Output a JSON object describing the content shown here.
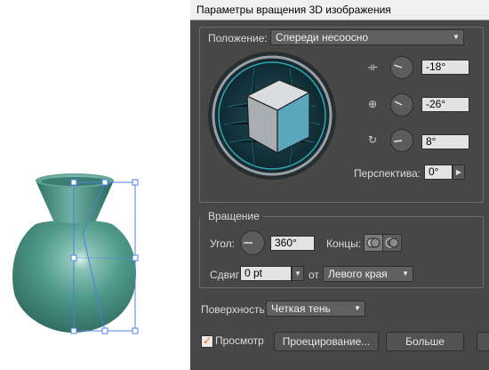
{
  "dialog": {
    "title": "Параметры вращения 3D изображения",
    "position": {
      "label": "Положение:",
      "preset_value": "Спереди несоосно",
      "x_rotation": "-18°",
      "y_rotation": "-26°",
      "z_rotation": "8°",
      "x_dial_angle": -18,
      "y_dial_angle": -26,
      "z_dial_angle": 8,
      "perspective_label": "Перспектива:",
      "perspective_value": "0°"
    },
    "revolve": {
      "label": "Вращение",
      "angle_label": "Угол:",
      "angle_value": "360°",
      "caps_label": "Концы:",
      "offset_label": "Сдвиг:",
      "offset_value": "0 pt",
      "from_label": "от",
      "edge_value": "Левого края"
    },
    "surface": {
      "label": "Поверхность:",
      "value": "Четкая тень"
    },
    "footer": {
      "preview_label": "Просмотр",
      "preview_checked": true,
      "map_art_button": "Проецирование...",
      "more_options_button": "Больше"
    }
  },
  "colors": {
    "dialog_bg": "#474747",
    "cube_front": "#5aa7bd",
    "cube_top": "#d9dde0",
    "cube_side": "#a9aeb2",
    "vase": "#3f8a7c",
    "selection": "#4a7fe0",
    "accent_check": "#ff6a00"
  }
}
